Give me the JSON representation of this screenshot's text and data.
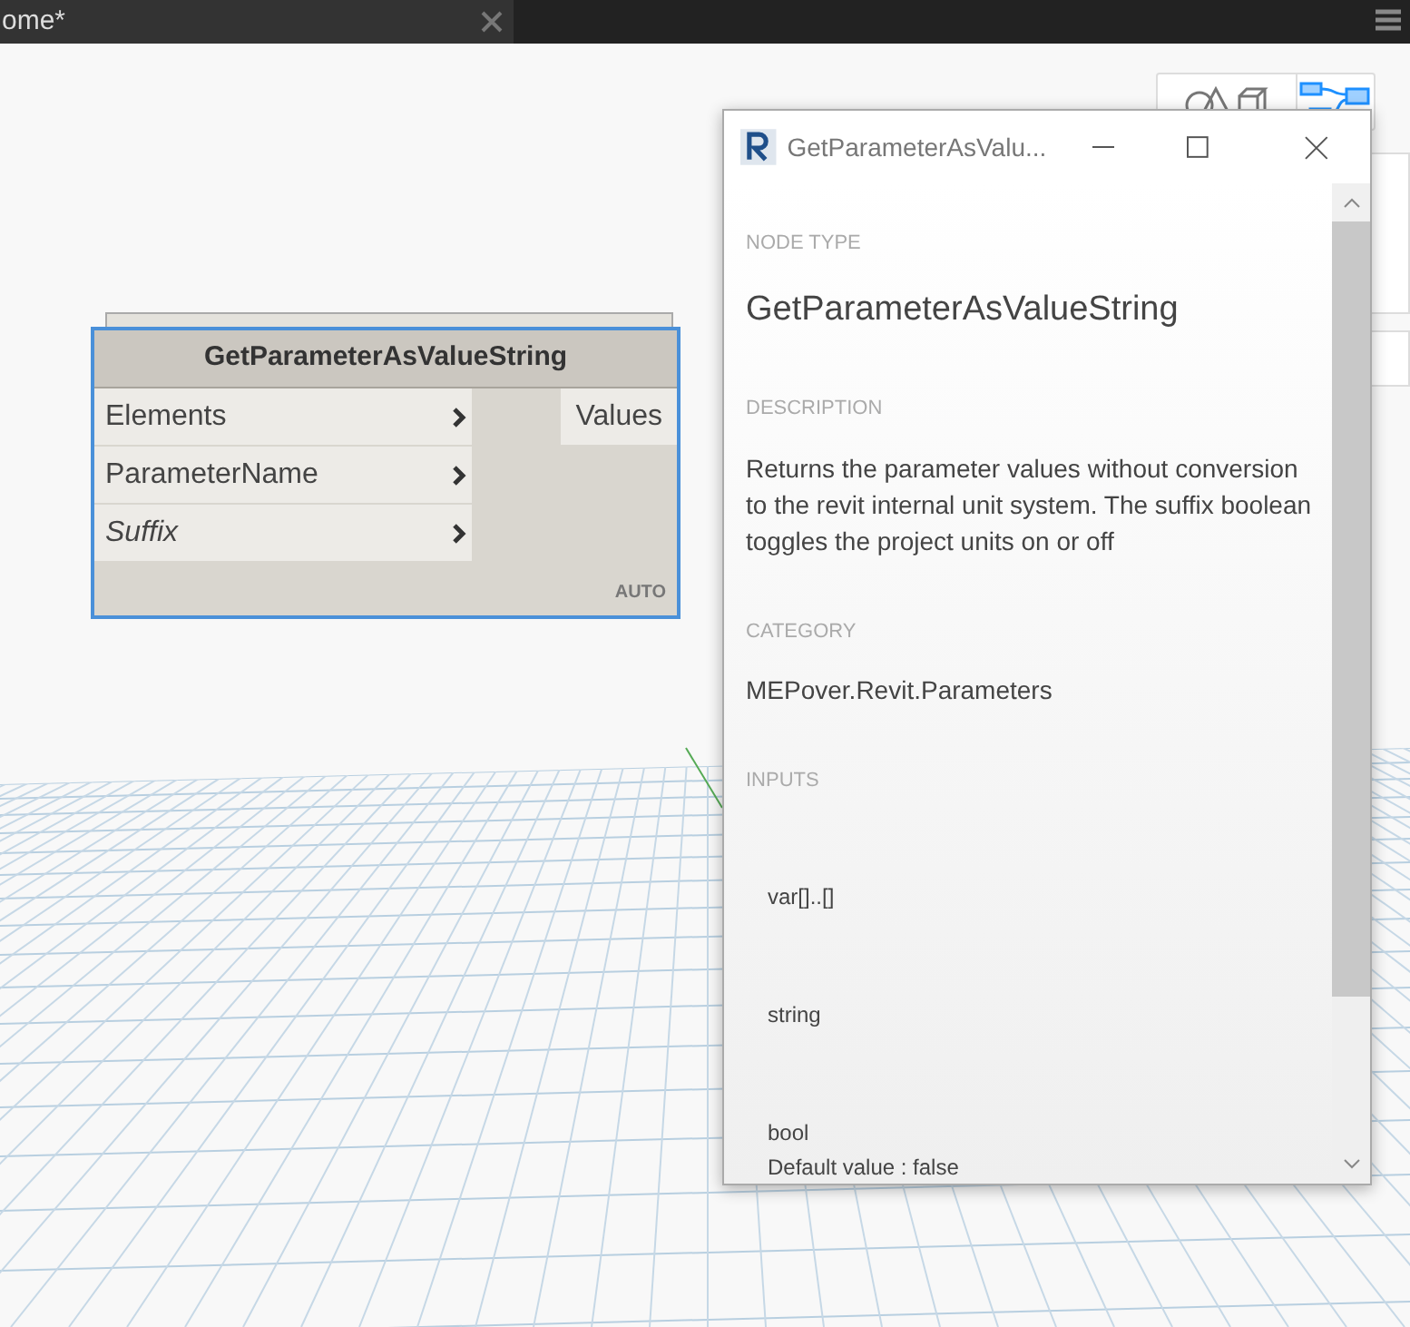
{
  "tab": {
    "title": "ome*"
  },
  "view_buttons": [
    {
      "kind": "geometry",
      "selected": false
    },
    {
      "kind": "graph",
      "selected": true
    }
  ],
  "node": {
    "title": "GetParameterAsValueString",
    "selected": true,
    "inputs": [
      {
        "label": "Elements",
        "has_default": false
      },
      {
        "label": "ParameterName",
        "has_default": false
      },
      {
        "label": "Suffix",
        "has_default": true
      }
    ],
    "outputs": [
      "Values"
    ],
    "lacing": "AUTO"
  },
  "info_window": {
    "title": "GetParameterAsValu...",
    "sections": [
      {
        "kind": "title",
        "heading": "NODE TYPE",
        "text": "GetParameterAsValueString"
      },
      {
        "kind": "text",
        "heading": "DESCRIPTION",
        "text": "Returns the parameter values without conversion to the revit internal unit system. The suffix boolean toggles the project units on or off"
      },
      {
        "kind": "text",
        "heading": "CATEGORY",
        "text": "MEPover.Revit.Parameters"
      },
      {
        "kind": "inputs",
        "heading": "INPUTS",
        "items": [
          {
            "type": "var[]..[]"
          },
          {
            "type": "string"
          },
          {
            "type": "bool",
            "default": "Default value : false"
          }
        ]
      }
    ]
  }
}
